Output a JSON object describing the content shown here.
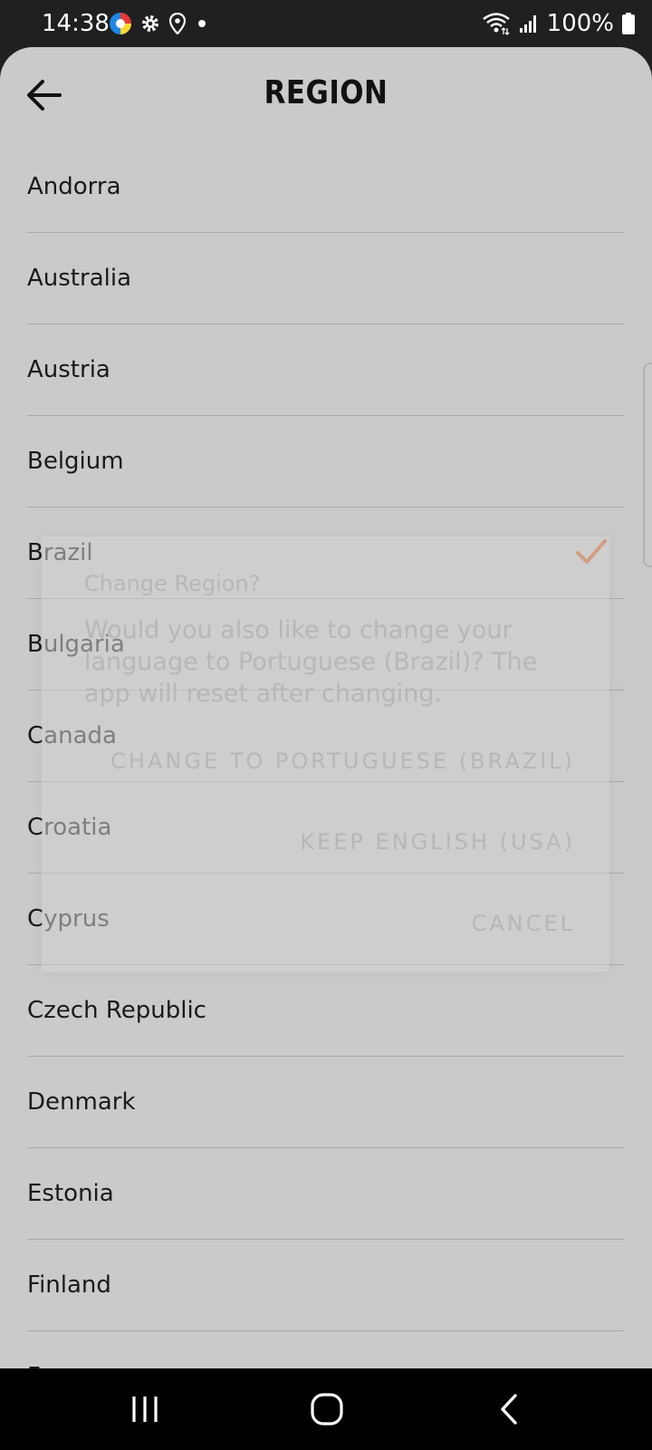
{
  "status_bar": {
    "time": "14:38",
    "battery_text": "100%"
  },
  "header": {
    "title": "REGION",
    "back_icon": "arrow-left-icon"
  },
  "regions": [
    {
      "label": "Andorra",
      "selected": false
    },
    {
      "label": "Australia",
      "selected": false
    },
    {
      "label": "Austria",
      "selected": false
    },
    {
      "label": "Belgium",
      "selected": false
    },
    {
      "label": "Brazil",
      "selected": true
    },
    {
      "label": "Bulgaria",
      "selected": false
    },
    {
      "label": "Canada",
      "selected": false
    },
    {
      "label": "Croatia",
      "selected": false
    },
    {
      "label": "Cyprus",
      "selected": false
    },
    {
      "label": "Czech Republic",
      "selected": false
    },
    {
      "label": "Denmark",
      "selected": false
    },
    {
      "label": "Estonia",
      "selected": false
    },
    {
      "label": "Finland",
      "selected": false
    },
    {
      "label": "France",
      "selected": false
    }
  ],
  "dialog": {
    "title": "Change Region?",
    "message": "Would you also like to change your language to Portuguese (Brazil)? The app will reset after changing.",
    "button_change": "CHANGE TO PORTUGUESE (BRAZIL)",
    "button_keep": "KEEP ENGLISH (USA)",
    "button_cancel": "CANCEL"
  },
  "colors": {
    "accent": "#d4621c",
    "background": "#cacaca",
    "divider": "#a9a9a9"
  }
}
